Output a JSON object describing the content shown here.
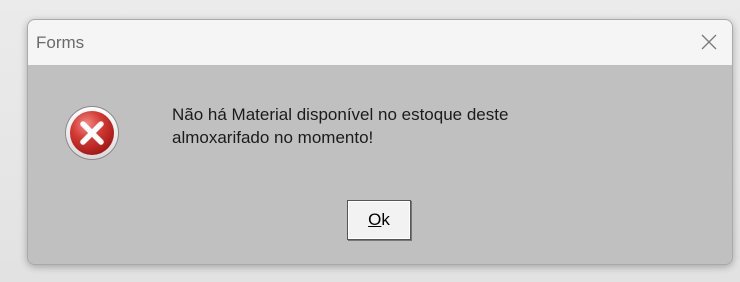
{
  "dialog": {
    "title": "Forms",
    "close_icon": "close-x-icon",
    "error_icon": "error-circle-x-icon",
    "message_lines": [
      "Não há Material disponível no estoque deste",
      "almoxarifado no momento!"
    ],
    "ok_button": {
      "mnemonic": "O",
      "rest": "k"
    }
  },
  "colors": {
    "titlebar": "#f5f5f5",
    "body": "#c0c0c0",
    "error_red": "#c8201f"
  }
}
